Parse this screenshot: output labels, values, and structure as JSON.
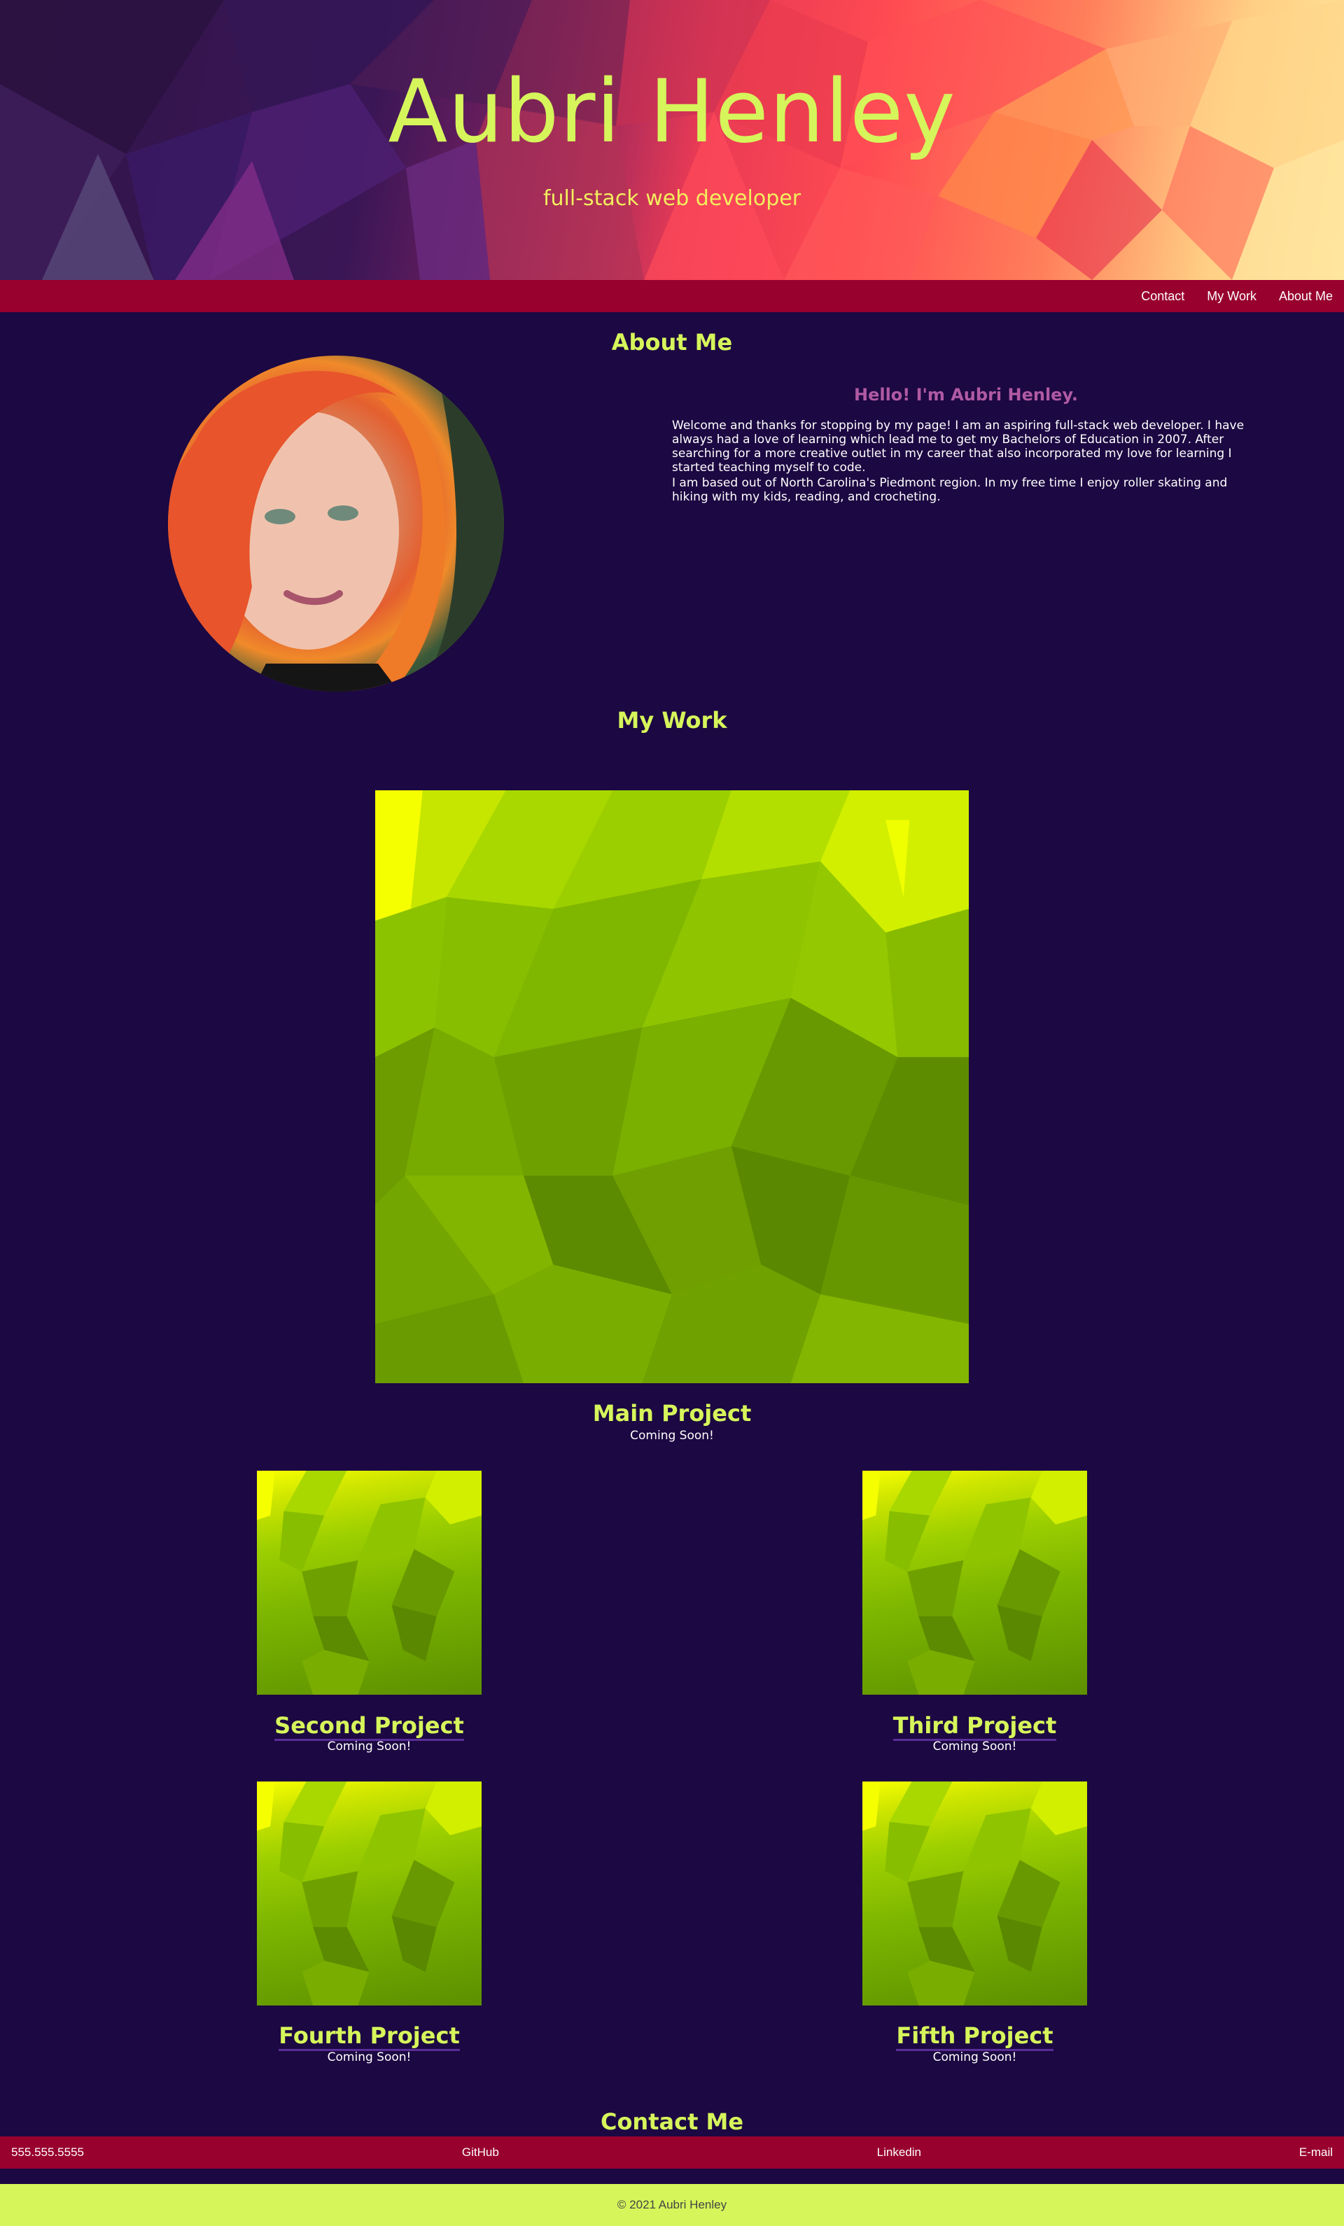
{
  "hero": {
    "name": "Aubri Henley",
    "tagline": "full-stack web developer"
  },
  "nav": {
    "items": [
      "Contact",
      "My Work",
      "About Me"
    ]
  },
  "about": {
    "heading": "About Me",
    "greeting": "Hello! I'm Aubri Henley.",
    "paragraphs": [
      "Welcome and thanks for stopping by my page! I am an aspiring full-stack web developer. I have always had a love of learning which lead me to get my Bachelors of Education in 2007. After searching for a more creative outlet in my career that also incorporated my love for learning I started teaching myself to code.",
      "I am based out of North Carolina's Piedmont region. In my free time I enjoy roller skating and hiking with my kids, reading, and crocheting."
    ]
  },
  "work": {
    "heading": "My Work",
    "main": {
      "title": "Main Project",
      "status": "Coming Soon!"
    },
    "projects": [
      {
        "title": "Second Project",
        "status": "Coming Soon!"
      },
      {
        "title": "Third Project",
        "status": "Coming Soon!"
      },
      {
        "title": "Fourth Project",
        "status": "Coming Soon!"
      },
      {
        "title": "Fifth Project",
        "status": "Coming Soon!"
      }
    ]
  },
  "contact": {
    "heading": "Contact Me",
    "links": [
      "555.555.5555",
      "GitHub",
      "Linkedin",
      "E-mail"
    ]
  },
  "footer": {
    "copyright": "© 2021 Aubri Henley"
  },
  "colors": {
    "background": "#1c0842",
    "accent": "#d6f55b",
    "nav_bar": "#98002e",
    "greeting": "#b05aa3"
  }
}
